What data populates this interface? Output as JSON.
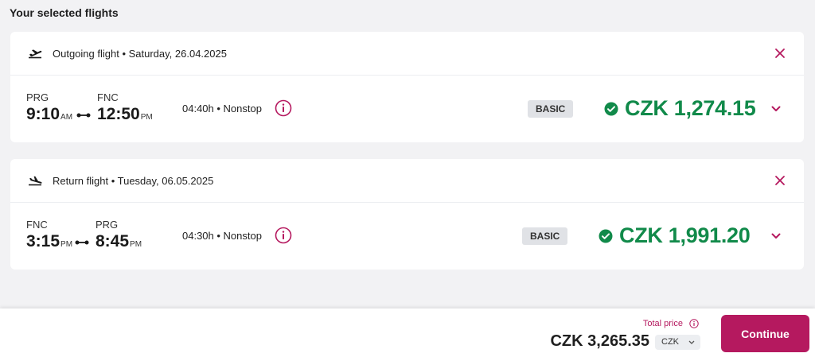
{
  "page_title": "Your selected flights",
  "colors": {
    "accent": "#b5195f",
    "price_green": "#118a4a",
    "badge_bg": "#e0e2e6"
  },
  "flights": [
    {
      "header": "Outgoing flight • Saturday, 26.04.2025",
      "header_icon": "plane-departure-icon",
      "from_code": "PRG",
      "from_time": "9:10",
      "from_ampm": "AM",
      "to_code": "FNC",
      "to_time": "12:50",
      "to_ampm": "PM",
      "duration": "04:40h • Nonstop",
      "fare": "BASIC",
      "price": "CZK 1,274.15"
    },
    {
      "header": "Return flight • Tuesday, 06.05.2025",
      "header_icon": "plane-arrival-icon",
      "from_code": "FNC",
      "from_time": "3:15",
      "from_ampm": "PM",
      "to_code": "PRG",
      "to_time": "8:45",
      "to_ampm": "PM",
      "duration": "04:30h • Nonstop",
      "fare": "BASIC",
      "price": "CZK 1,991.20"
    }
  ],
  "footer": {
    "total_label": "Total price",
    "total_price": "CZK 3,265.35",
    "currency": "CZK",
    "continue_label": "Continue"
  }
}
